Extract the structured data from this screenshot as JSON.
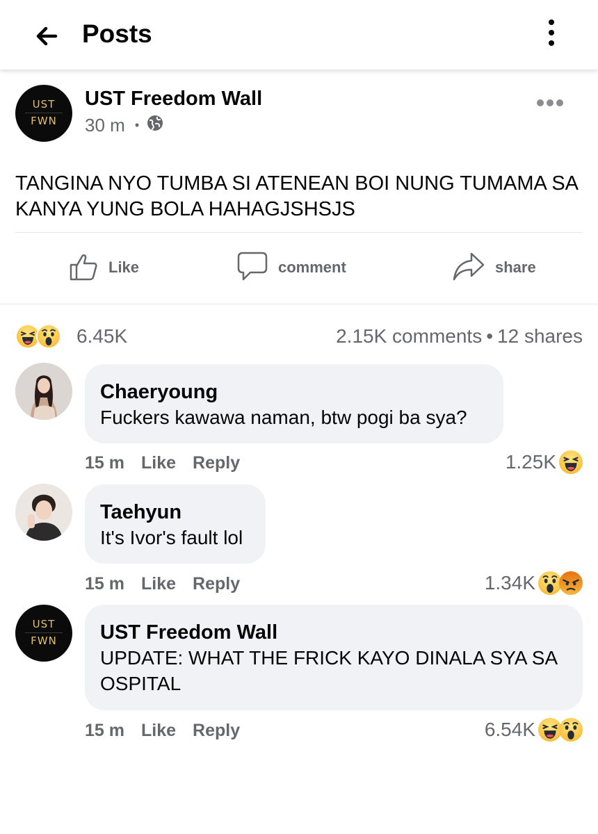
{
  "header": {
    "back_icon": "arrow-left-icon",
    "title": "Posts",
    "more_icon": "vertical-dots-icon"
  },
  "post": {
    "avatar": {
      "line1": "UST",
      "line2": "FWN"
    },
    "author": "UST Freedom Wall",
    "time": "30 m",
    "separator": "•",
    "privacy_icon": "globe-icon",
    "more_icon": "horizontal-dots-icon",
    "text": "TANGINA NYO TUMBA SI ATENEAN BOI NUNG TUMAMA SA KANYA YUNG BOLA HAHAGJSHSJS",
    "actions": [
      {
        "label": "Like",
        "icon": "thumbs-up-icon"
      },
      {
        "label": "comment",
        "icon": "comment-icon"
      },
      {
        "label": "share",
        "icon": "share-icon"
      }
    ],
    "reactions": {
      "icons": [
        "haha-emoji-icon",
        "wow-emoji-icon"
      ],
      "count": "6.45K"
    },
    "comments_count": "2.15K comments",
    "shares_count": "12 shares",
    "stats_separator": "•"
  },
  "comments": [
    {
      "author": "Chaeryoung",
      "text": "Fuckers kawawa naman, btw pogi ba sya?",
      "time": "15 m",
      "like_label": "Like",
      "reply_label": "Reply",
      "reaction_count": "1.25K",
      "reaction_icons": [
        "haha-emoji-icon"
      ]
    },
    {
      "author": "Taehyun",
      "text": "It's Ivor's fault lol",
      "time": "15 m",
      "like_label": "Like",
      "reply_label": "Reply",
      "reaction_count": "1.34K",
      "reaction_icons": [
        "wow-emoji-icon",
        "angry-emoji-icon"
      ]
    },
    {
      "author": "UST Freedom Wall",
      "avatar": {
        "line1": "UST",
        "line2": "FWN"
      },
      "text": "UPDATE: WHAT THE FRICK KAYO DINALA SYA SA OSPITAL",
      "time": "15 m",
      "like_label": "Like",
      "reply_label": "Reply",
      "reaction_count": "6.54K",
      "reaction_icons": [
        "haha-emoji-icon",
        "wow-emoji-icon"
      ]
    }
  ],
  "colors": {
    "text_primary": "#050505",
    "text_secondary": "#65676b",
    "bubble_bg": "#f0f2f5",
    "avatar_gold": "#e4c06a",
    "reaction_yellow": "#f7b125"
  }
}
